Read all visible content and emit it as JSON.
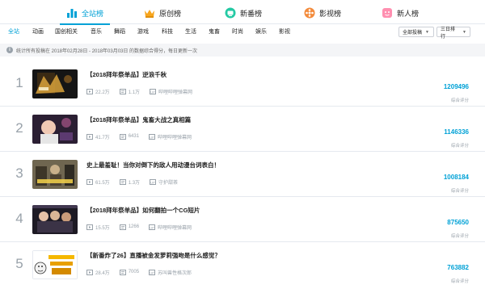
{
  "top_tabs": [
    {
      "label": "全站榜",
      "icon": "bar-chart-icon",
      "active": true
    },
    {
      "label": "原创榜",
      "icon": "crown-icon",
      "active": false
    },
    {
      "label": "新番榜",
      "icon": "tv-icon",
      "active": false
    },
    {
      "label": "影视榜",
      "icon": "film-reel-icon",
      "active": false
    },
    {
      "label": "新人榜",
      "icon": "face-icon",
      "active": false
    }
  ],
  "categories": [
    "全站",
    "动画",
    "国创相关",
    "音乐",
    "舞蹈",
    "游戏",
    "科技",
    "生活",
    "鬼畜",
    "时尚",
    "娱乐",
    "影视"
  ],
  "filters": {
    "type": "全部投稿",
    "range": "三日排行"
  },
  "info_text": "统计所有投稿在 2018年02月28日 - 2018年03月03日 的数据综合得分，每日更新一次",
  "score_label": "综合评分",
  "accent_color": "#00a1d6",
  "items": [
    {
      "rank": "1",
      "title": "【2018拜年祭单品】逆浪千秋",
      "plays": "22.2万",
      "danmaku": "1.1万",
      "up": "哔哩哔哩弹幕网",
      "score": "1209496"
    },
    {
      "rank": "2",
      "title": "【2018拜年祭单品】鬼畜大战之真相篇",
      "plays": "41.7万",
      "danmaku": "6431",
      "up": "哔哩哔哩弹幕网",
      "score": "1146336"
    },
    {
      "rank": "3",
      "title": "史上最羞耻！当你对倒下的敌人用动漫台词表白！",
      "plays": "61.5万",
      "danmaku": "1.3万",
      "up": "守护甜茶",
      "score": "1008184"
    },
    {
      "rank": "4",
      "title": "【2018拜年祭单品】如何翻拍一个CG短片",
      "plays": "15.5万",
      "danmaku": "1266",
      "up": "哔哩哔哩弹幕网",
      "score": "875650"
    },
    {
      "rank": "5",
      "title": "【新番炸了26】直播被金发萝莉强吻是什么感觉？",
      "plays": "28.4万",
      "danmaku": "7005",
      "up": "苏叫兽性格次郎",
      "score": "763882"
    }
  ]
}
